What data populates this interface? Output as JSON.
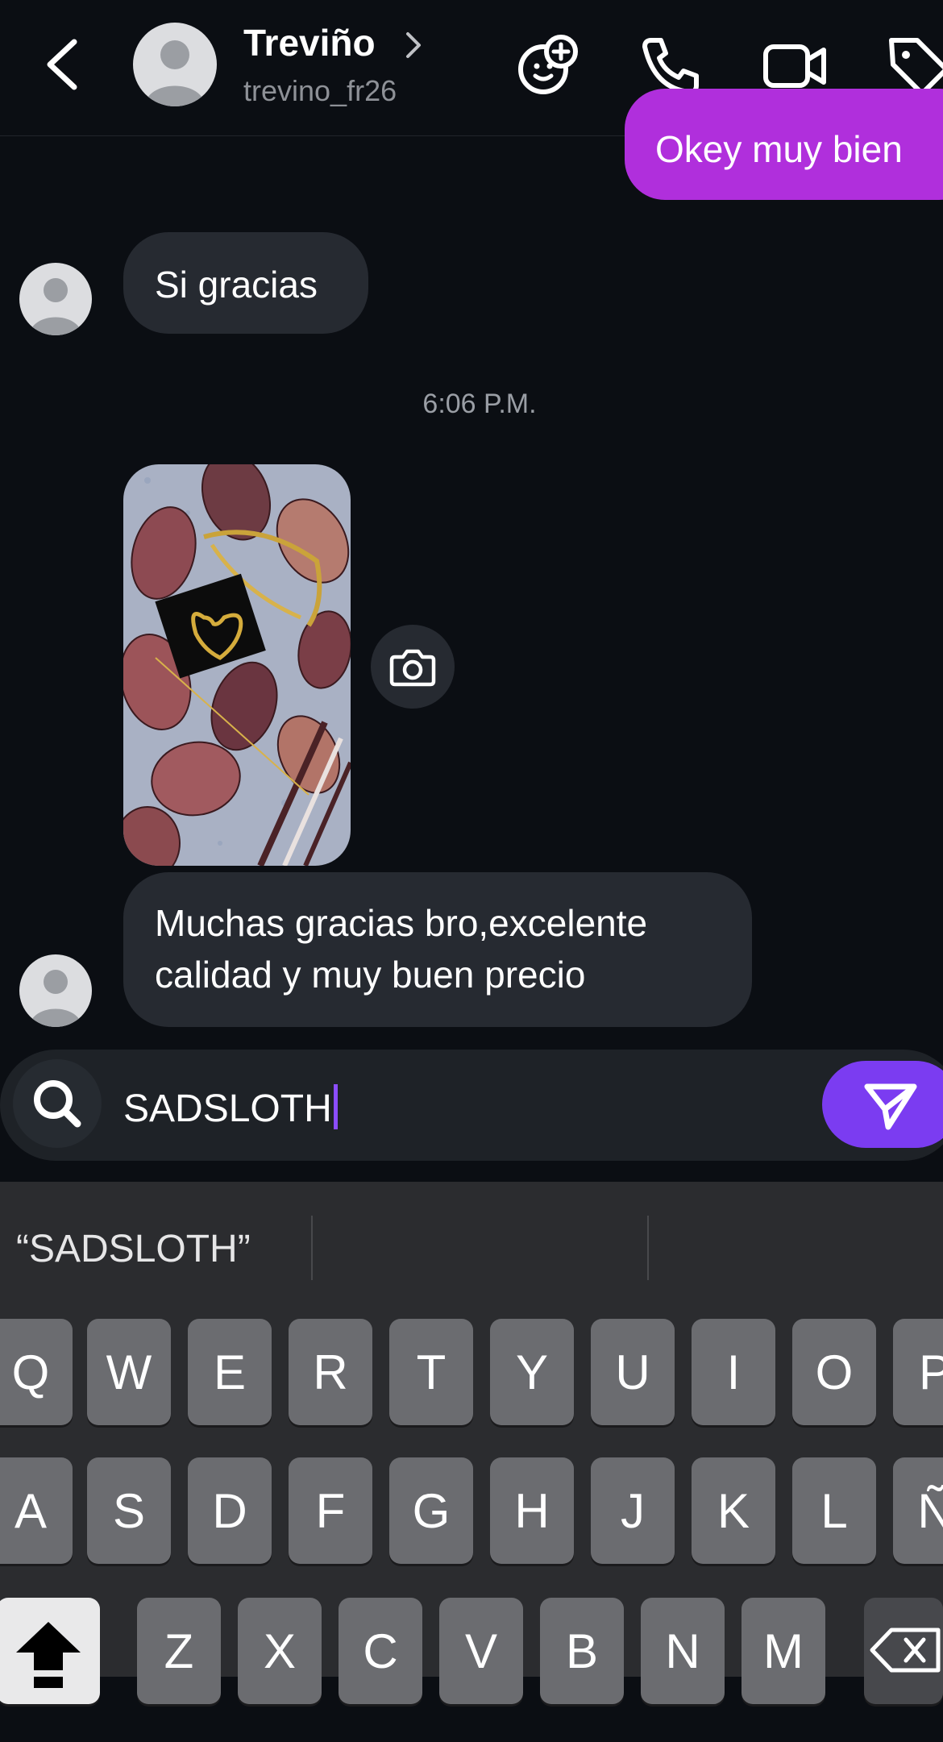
{
  "header": {
    "contact_name": "Treviño",
    "username": "trevino_fr26",
    "icons": [
      "back-icon",
      "chevron-right-icon",
      "add-effects-icon",
      "phone-icon",
      "video-icon",
      "tag-icon"
    ]
  },
  "messages": {
    "outgoing_1": "Okey muy bien",
    "incoming_1": "Si gracias",
    "timestamp": "6:06 P.M.",
    "incoming_2_line1": "Muchas gracias bro,excelente",
    "incoming_2_line2": "calidad y muy buen precio"
  },
  "composer": {
    "value": "SADSLOTH",
    "search_icon": "search-icon",
    "send_icon": "send-icon"
  },
  "keyboard": {
    "suggestion": "“SADSLOTH”",
    "row1": [
      "Q",
      "W",
      "E",
      "R",
      "T",
      "Y",
      "U",
      "I",
      "O",
      "P"
    ],
    "row2": [
      "A",
      "S",
      "D",
      "F",
      "G",
      "H",
      "J",
      "K",
      "L",
      "Ñ"
    ],
    "row3": [
      "Z",
      "X",
      "C",
      "V",
      "B",
      "N",
      "M"
    ]
  },
  "colors": {
    "outgoing_bubble": "#b02fdc",
    "incoming_bubble": "#262a31",
    "send_button": "#7b3cf1",
    "background": "#0b0e13"
  }
}
